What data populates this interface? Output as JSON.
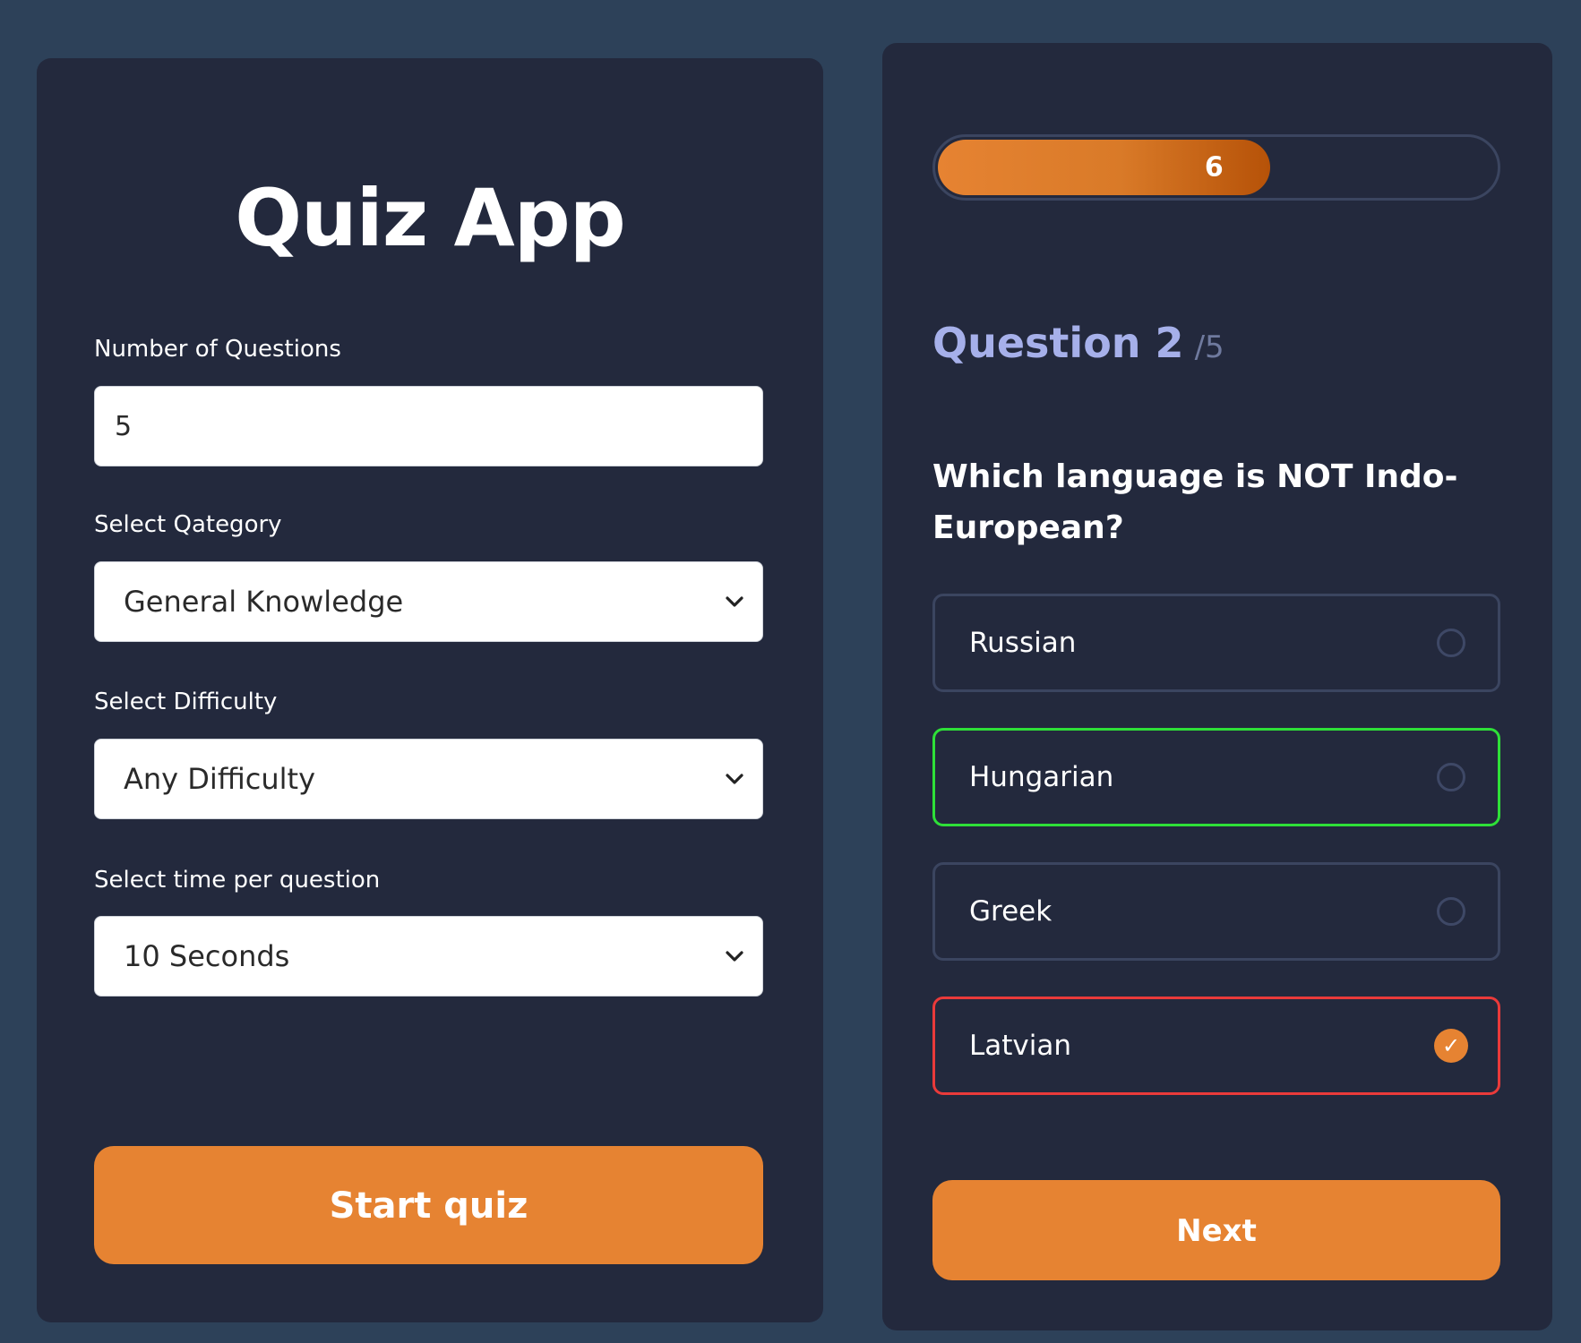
{
  "setup": {
    "title": "Quiz App",
    "num_questions_label": "Number of Questions",
    "num_questions_value": "5",
    "category_label": "Select Qategory",
    "category_value": "General Knowledge",
    "difficulty_label": "Select Difficulty",
    "difficulty_value": "Any Difficulty",
    "time_label": "Select time per question",
    "time_value": "10 Seconds",
    "start_label": "Start quiz"
  },
  "quiz": {
    "timer_value": "6",
    "timer_progress_fraction": 0.6,
    "question_label": "Question 2",
    "question_total": "/5",
    "question_text": "Which language is NOT Indo-European?",
    "options": [
      {
        "label": "Russian",
        "state": "default",
        "selected": false
      },
      {
        "label": "Hungarian",
        "state": "correct",
        "selected": false
      },
      {
        "label": "Greek",
        "state": "default",
        "selected": false
      },
      {
        "label": "Latvian",
        "state": "wrong",
        "selected": true
      }
    ],
    "check_glyph": "✓",
    "next_label": "Next"
  },
  "colors": {
    "background": "#2d4159",
    "panel": "#23293d",
    "accent": "#e68332",
    "correct": "#2ee038",
    "wrong": "#ea3a3a",
    "question_heading": "#a6b0ea"
  },
  "icons": {
    "select_arrow": "chevron-down-icon",
    "option_marker": "radio-circle-icon",
    "selected_marker": "check-icon"
  }
}
